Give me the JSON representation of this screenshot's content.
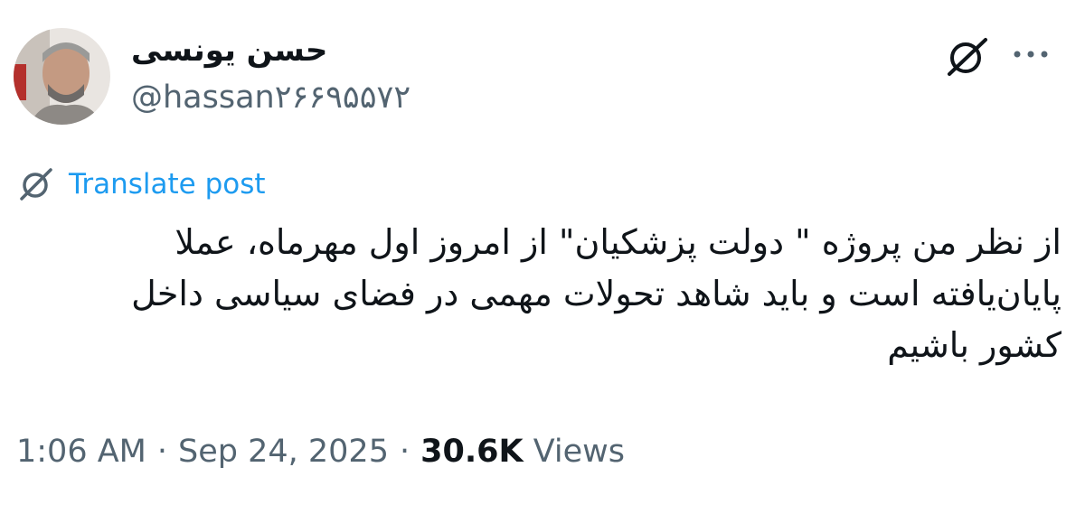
{
  "author": {
    "display_name": "حسن یونسی",
    "handle": "@hassan۲۶۶۹۵۵۷۲"
  },
  "header_icons": {
    "grok": "grok-icon",
    "more": "more-options-icon"
  },
  "translate": {
    "label": "Translate post",
    "icon": "grok-icon"
  },
  "post": {
    "text": "از نظر من پروژه \" دولت پزشکیان\" از امروز اول مهرماه، عملا پایان‌یافته است و باید شاهد تحولات مهمی در فضای سیاسی داخل کشور باشیم"
  },
  "meta": {
    "time": "1:06 AM",
    "date": "Sep 24, 2025",
    "separator": "·",
    "views_count": "30.6K",
    "views_label": "Views"
  },
  "colors": {
    "link_blue": "#1d9bf0",
    "secondary_text": "#536471",
    "primary_text": "#0f1419"
  }
}
